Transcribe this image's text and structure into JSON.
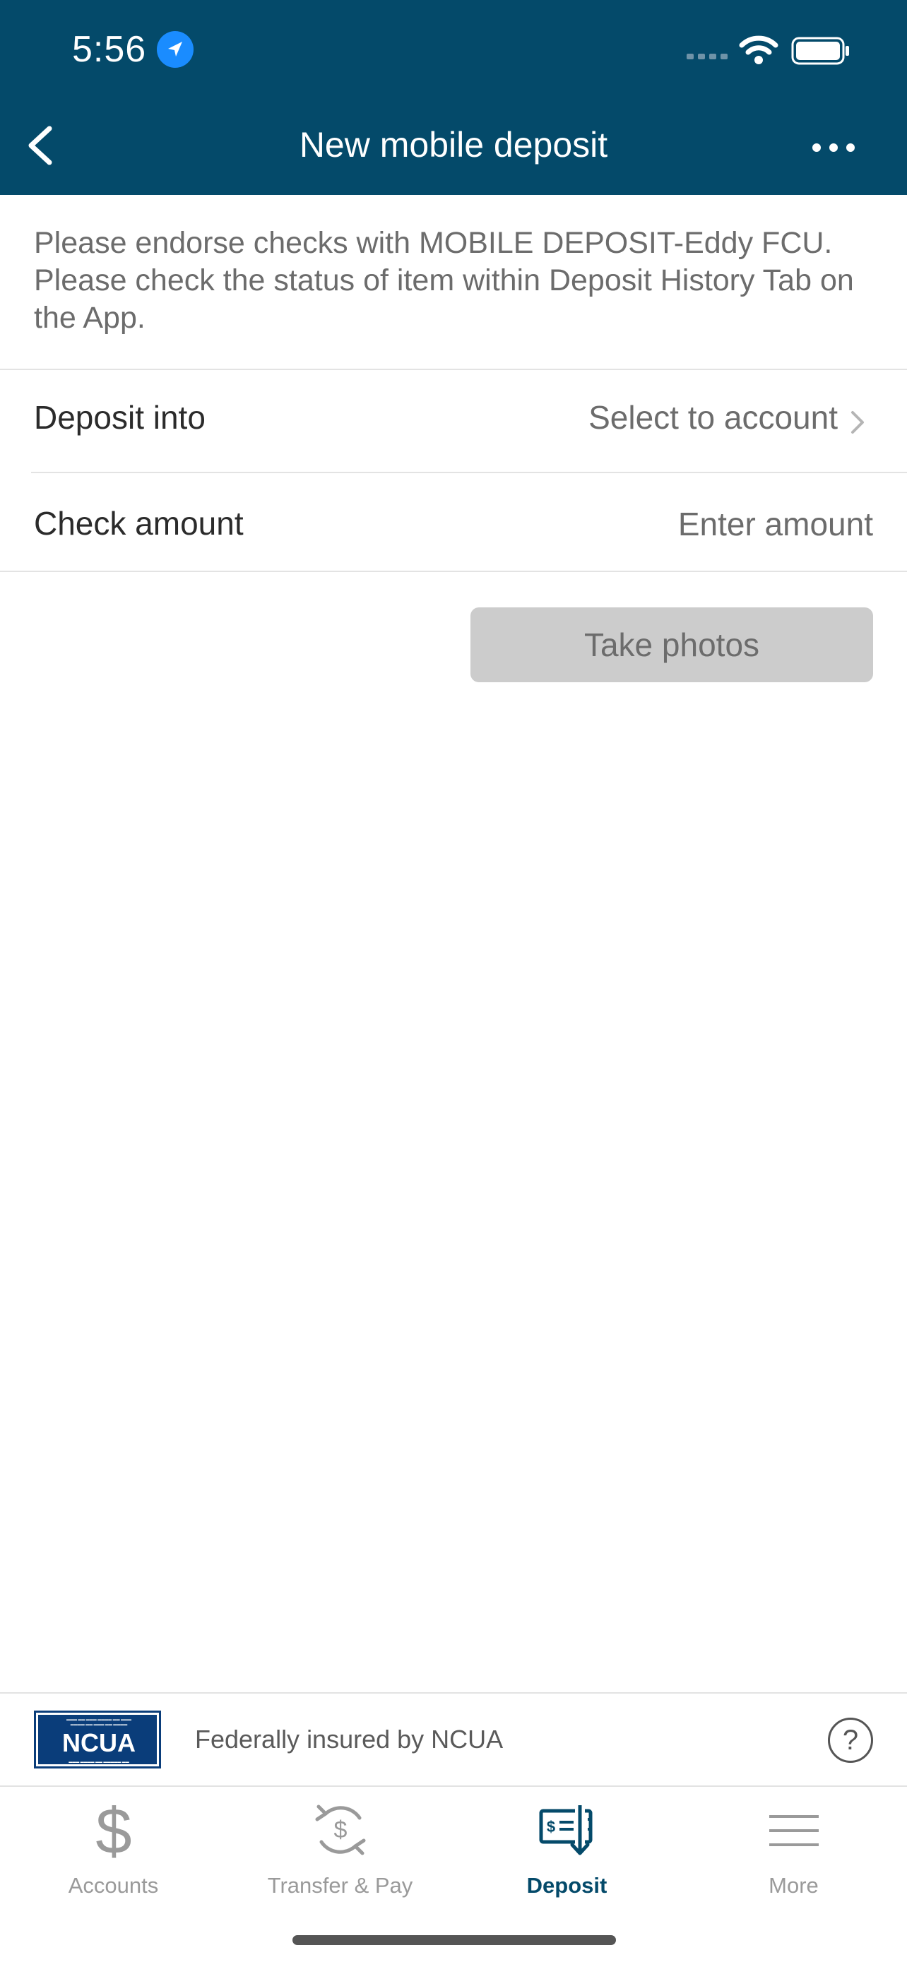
{
  "status_bar": {
    "time": "5:56"
  },
  "nav": {
    "title": "New mobile deposit"
  },
  "notice": "Please endorse checks with MOBILE DEPOSIT-Eddy FCU. Please check the status of item within Deposit History Tab on the App.",
  "form": {
    "deposit_into_label": "Deposit into",
    "deposit_into_value": "Select to account",
    "check_amount_label": "Check amount",
    "check_amount_placeholder": "Enter amount"
  },
  "take_photos_label": "Take photos",
  "insurance": {
    "logo_text": "NCUA",
    "text": "Federally insured by NCUA"
  },
  "tabs": [
    {
      "label": "Accounts",
      "icon": "dollar-icon",
      "active": false
    },
    {
      "label": "Transfer & Pay",
      "icon": "transfer-pay-icon",
      "active": false
    },
    {
      "label": "Deposit",
      "icon": "check-deposit-icon",
      "active": true
    },
    {
      "label": "More",
      "icon": "menu-icon",
      "active": false
    }
  ],
  "colors": {
    "header": "#044a6a",
    "active_tab": "#044a6a",
    "disabled_button": "#cccccc"
  }
}
